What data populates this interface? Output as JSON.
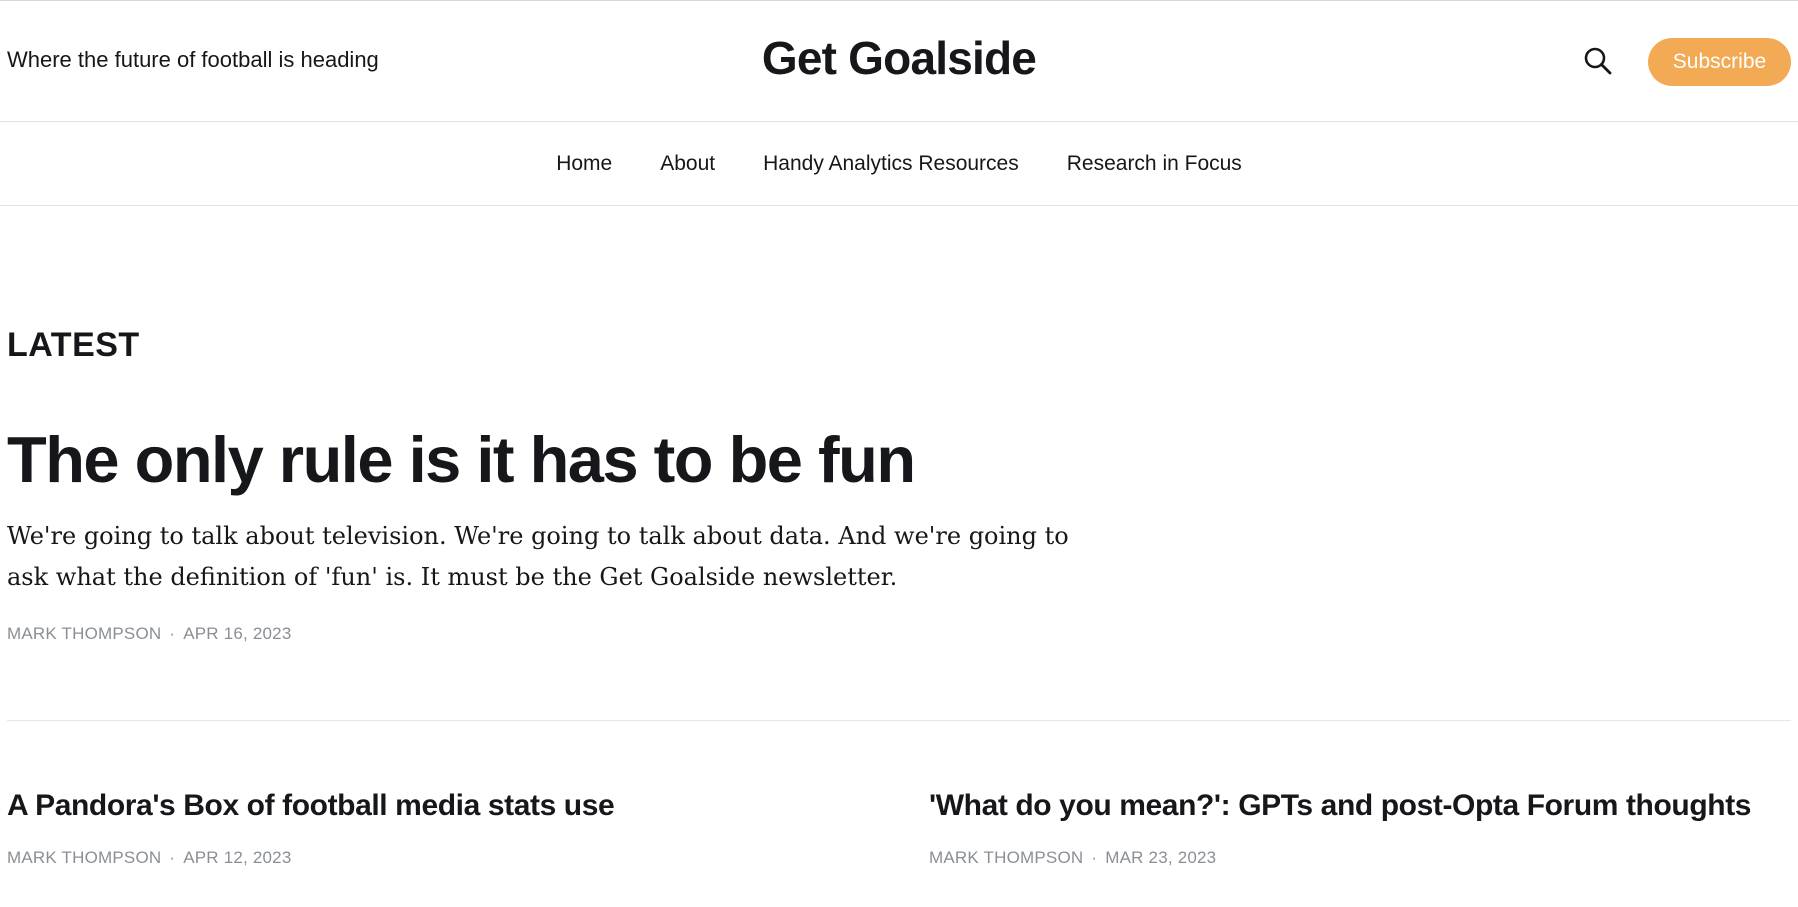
{
  "header": {
    "tagline": "Where the future of football is heading",
    "brand": "Get Goalside",
    "subscribe_label": "Subscribe",
    "search_icon": "search-icon",
    "accent_color": "#f3aa55"
  },
  "nav": {
    "items": [
      {
        "label": "Home"
      },
      {
        "label": "About"
      },
      {
        "label": "Handy Analytics Resources"
      },
      {
        "label": "Research in Focus"
      }
    ]
  },
  "main": {
    "section_label": "LATEST",
    "feature": {
      "title": "The only rule is it has to be fun",
      "excerpt": "We're going to talk about television. We're going to talk about data. And we're going to ask what the definition of 'fun' is. It must be the Get Goalside newsletter.",
      "author": "MARK THOMPSON",
      "date": "APR 16, 2023"
    },
    "posts": [
      {
        "title": "A Pandora's Box of football media stats use",
        "author": "MARK THOMPSON",
        "date": "APR 12, 2023"
      },
      {
        "title": "'What do you mean?': GPTs and post-Opta Forum thoughts",
        "author": "MARK THOMPSON",
        "date": "MAR 23, 2023"
      }
    ],
    "separator": "·"
  }
}
